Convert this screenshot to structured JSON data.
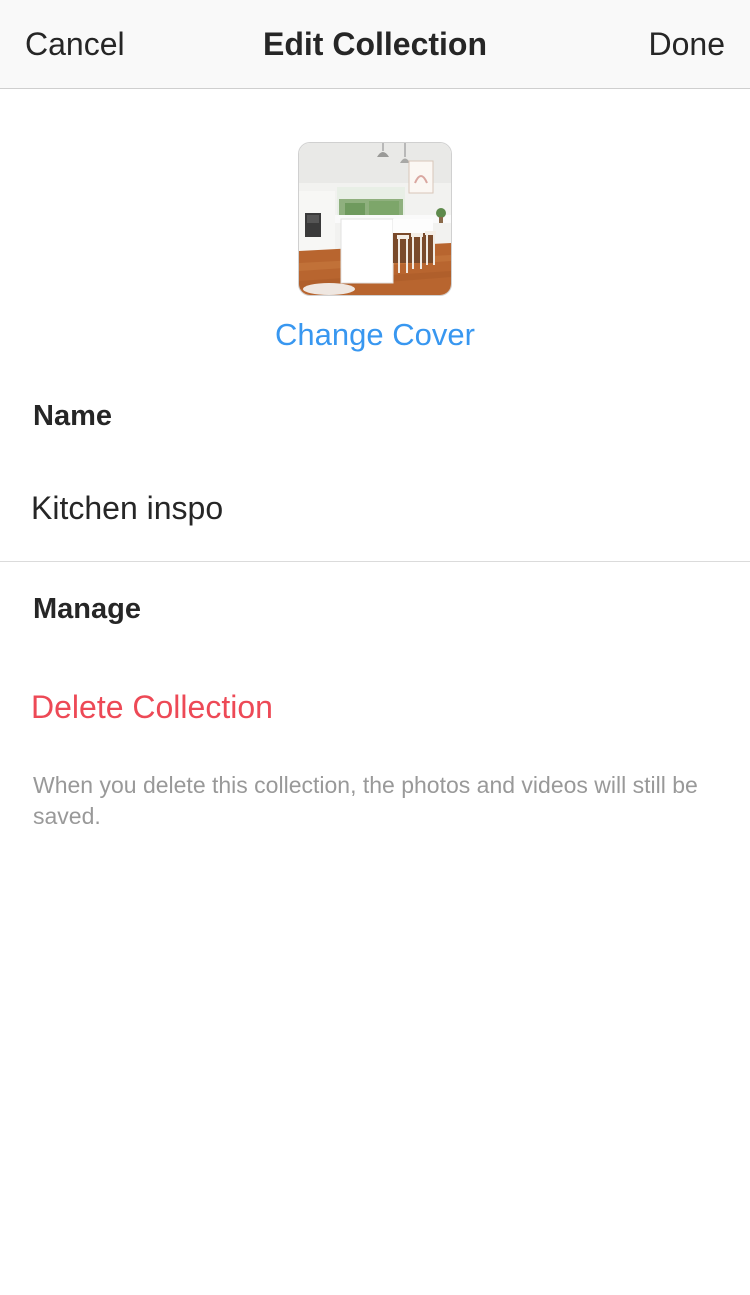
{
  "navbar": {
    "cancel_label": "Cancel",
    "title": "Edit Collection",
    "done_label": "Done"
  },
  "cover": {
    "image_icon": "kitchen-cover-photo",
    "change_label": "Change Cover"
  },
  "name_section": {
    "label": "Name",
    "value": "Kitchen inspo"
  },
  "manage_section": {
    "label": "Manage",
    "delete_label": "Delete Collection",
    "delete_note": "When you delete this collection, the photos and videos will still be saved."
  },
  "colors": {
    "link_blue": "#3897f0",
    "destructive_red": "#ed4956",
    "text_primary": "#262626",
    "text_secondary": "#999999",
    "navbar_bg": "#f9f9f9"
  }
}
